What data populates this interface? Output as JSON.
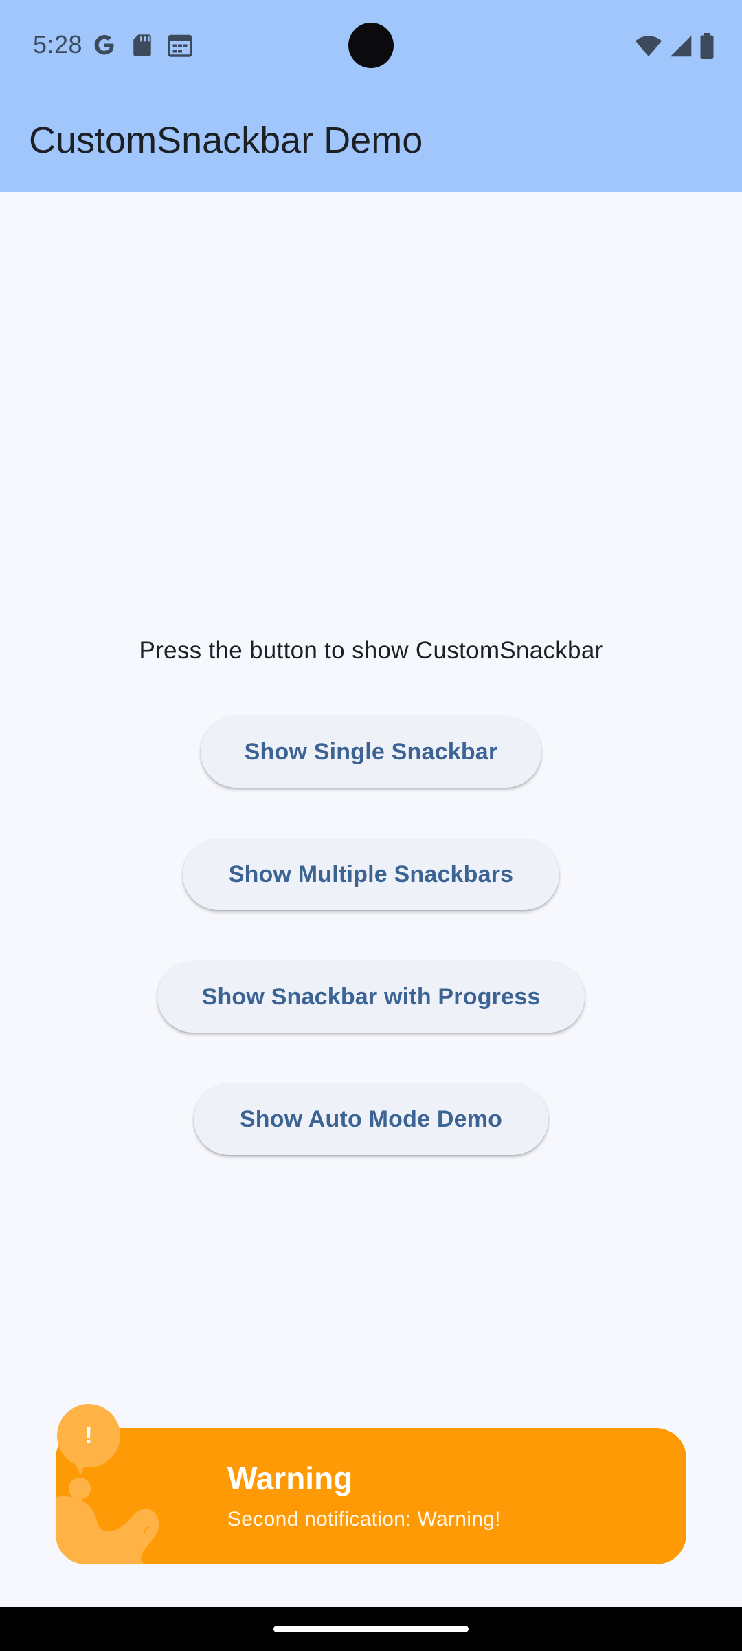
{
  "status_bar": {
    "time": "5:28",
    "left_icons": [
      "google-icon",
      "sd-card-icon",
      "calendar-icon"
    ],
    "right_icons": [
      "wifi-icon",
      "cellular-signal-icon",
      "battery-icon"
    ]
  },
  "app_bar": {
    "title": "CustomSnackbar Demo",
    "color": "#a0c6fb"
  },
  "main": {
    "prompt": "Press the button to show CustomSnackbar",
    "buttons": [
      {
        "label": "Show Single Snackbar"
      },
      {
        "label": "Show Multiple Snackbars"
      },
      {
        "label": "Show Snackbar with Progress"
      },
      {
        "label": "Show Auto Mode Demo"
      }
    ]
  },
  "snackbar": {
    "badge": "!",
    "title": "Warning",
    "message": "Second notification: Warning!",
    "color": "#fe9a06",
    "icon": "warning-bubble-icon"
  },
  "navigation_bar": {
    "handle": "home-gesture-handle"
  }
}
